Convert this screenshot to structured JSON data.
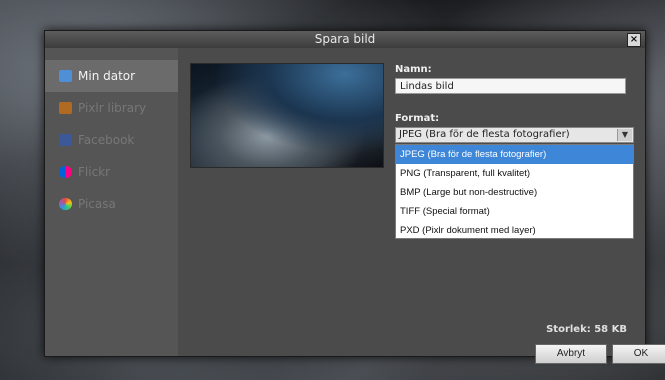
{
  "dialog": {
    "title": "Spara bild",
    "close_glyph": "×"
  },
  "sidebar": {
    "items": [
      {
        "label": "Min dator",
        "icon": "monitor-icon",
        "color": "#4f8fd6"
      },
      {
        "label": "Pixlr library",
        "icon": "library-icon",
        "color": "#d88c2b"
      },
      {
        "label": "Facebook",
        "icon": "facebook-icon",
        "color": "#3b5998"
      },
      {
        "label": "Flickr",
        "icon": "flickr-icon",
        "color": "#ff0084"
      },
      {
        "label": "Picasa",
        "icon": "picasa-icon",
        "color": "#5cb85c"
      }
    ]
  },
  "form": {
    "name_label": "Namn:",
    "name_value": "Lindas bild",
    "format_label": "Format:",
    "format_selected": "JPEG (Bra för de flesta fotografier)",
    "format_options": [
      "JPEG (Bra för de flesta fotografier)",
      "PNG (Transparent, full kvalitet)",
      "BMP (Large but non-destructive)",
      "TIFF (Special format)",
      "PXD (Pixlr dokument med layer)"
    ]
  },
  "status": {
    "size": "Storlek: 58 KB"
  },
  "buttons": {
    "cancel": "Avbryt",
    "ok": "OK"
  },
  "colors": {
    "accent": "#3e86d8"
  }
}
